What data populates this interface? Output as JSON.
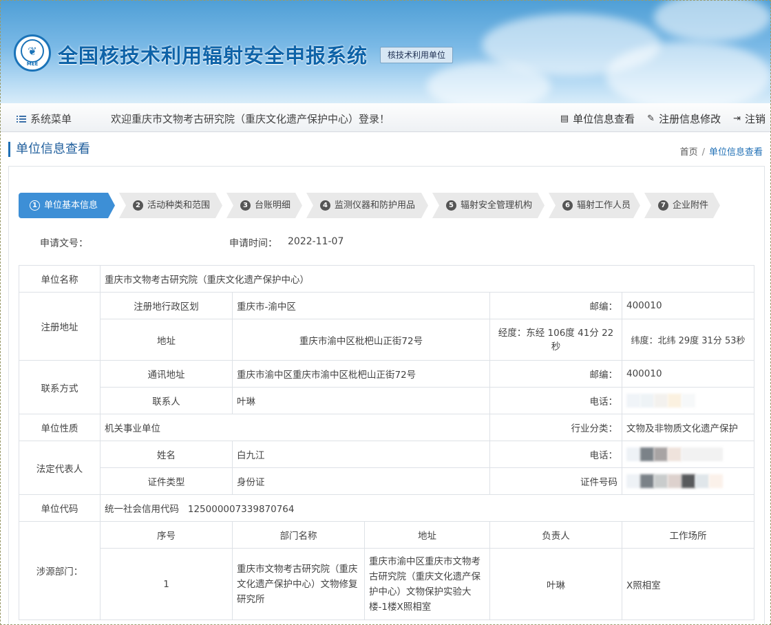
{
  "header": {
    "logo_text": "MEE",
    "system_title": "全国核技术利用辐射安全申报系统",
    "unit_badge": "核技术利用单位"
  },
  "navbar": {
    "menu_label": "系统菜单",
    "welcome": "欢迎重庆市文物考古研究院（重庆文化遗产保护中心）登录！",
    "links": [
      "单位信息查看",
      "注册信息修改",
      "注销"
    ]
  },
  "page": {
    "title": "单位信息查看",
    "breadcrumb": [
      "首页",
      "单位信息查看"
    ]
  },
  "steps": [
    {
      "num": "1",
      "label": "单位基本信息"
    },
    {
      "num": "2",
      "label": "活动种类和范围"
    },
    {
      "num": "3",
      "label": "台账明细"
    },
    {
      "num": "4",
      "label": "监测仪器和防护用品"
    },
    {
      "num": "5",
      "label": "辐射安全管理机构"
    },
    {
      "num": "6",
      "label": "辐射工作人员"
    },
    {
      "num": "7",
      "label": "企业附件"
    }
  ],
  "meta": {
    "doc_no_label": "申请文号：",
    "doc_no_value": "",
    "apply_time_label": "申请时间：",
    "apply_time_value": "2022-11-07"
  },
  "info": {
    "unit_name_label": "单位名称",
    "unit_name": "重庆市文物考古研究院（重庆文化遗产保护中心）",
    "reg_addr_label": "注册地址",
    "admin_region_label": "注册地行政区划",
    "admin_region": "重庆市-渝中区",
    "postcode_label": "邮编：",
    "postcode": "400010",
    "addr_label": "地址",
    "addr": "重庆市渝中区枇杷山正街72号",
    "longitude": "经度：东经 106度 41分 22秒",
    "latitude": "纬度：北纬 29度 31分 53秒",
    "contact_label": "联系方式",
    "mail_addr_label": "通讯地址",
    "mail_addr": "重庆市渝中区重庆市渝中区枇杷山正街72号",
    "postcode2": "400010",
    "contact_person_label": "联系人",
    "contact_person": "叶琳",
    "phone_label": "电话：",
    "nature_label": "单位性质",
    "nature": "机关事业单位",
    "industry_label": "行业分类：",
    "industry": "文物及非物质文化遗产保护",
    "legal_rep_label": "法定代表人",
    "name_label": "姓名",
    "legal_name": "白九江",
    "id_type_label": "证件类型",
    "id_type": "身份证",
    "id_no_label": "证件号码",
    "unit_code_label": "单位代码",
    "credit_code_label": "统一社会信用代码",
    "credit_code": "125000007339870764",
    "dept_label": "涉源部门：",
    "dept_headers": [
      "序号",
      "部门名称",
      "地址",
      "负责人",
      "工作场所"
    ],
    "dept_rows": [
      {
        "no": "1",
        "name": "重庆市文物考古研究院（重庆文化遗产保护中心）文物修复研究所",
        "addr": "重庆市渝中区重庆市文物考古研究院（重庆文化遗产保护中心）文物保护实验大楼-1楼X照相室",
        "leader": "叶琳",
        "workplace": "X照相室"
      }
    ]
  },
  "colors": {
    "accent": "#3d8fd6",
    "title_blue": "#0e63a8"
  }
}
